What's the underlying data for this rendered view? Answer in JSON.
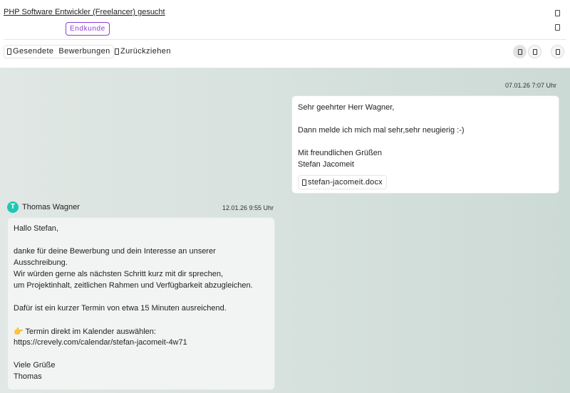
{
  "header": {
    "job_title": "PHP Software Entwickler (Freelancer) gesucht",
    "badge": "Endkunde"
  },
  "toolbar": {
    "sent_label": "Gesendete  Bewerbungen",
    "withdraw_label": "Zurückziehen"
  },
  "chat": {
    "outgoing": {
      "timestamp": "07.01.26 7:07 Uhr",
      "lines": [
        "Sehr geehrter Herr Wagner,",
        "Dann melde ich mich mal sehr,sehr neugierig :-)",
        "Mit freundlichen Grüßen",
        "Stefan Jacomeit"
      ],
      "attachment": "stefan-jacomeit.docx"
    },
    "incoming": {
      "avatar_initial": "T",
      "sender": "Thomas Wagner",
      "timestamp": "12.01.26 9:55 Uhr",
      "lines": [
        "Hallo Stefan,",
        "danke für deine Bewerbung und dein Interesse an unserer",
        "Ausschreibung.",
        "Wir würden gerne als nächsten Schritt kurz mit dir sprechen,",
        "um  Projektinhalt, zeitlichen Rahmen und Verfügbarkeit abzugleichen.",
        "Dafür ist ein kurzer Termin von etwa 15 Minuten ausreichend.",
        "👉 Termin direkt im  Kalender auswählen:",
        "https://crevely.com/calendar/stefan-jacomeit-4w71",
        "Viele Grüße",
        "Thomas"
      ]
    }
  }
}
